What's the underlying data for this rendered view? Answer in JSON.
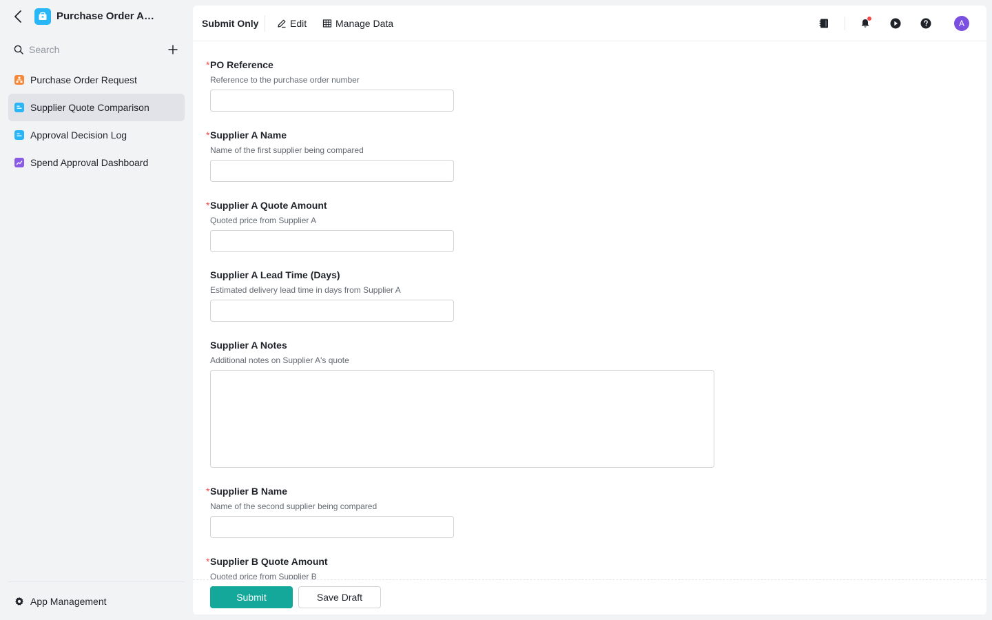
{
  "app": {
    "title": "Purchase Order App...",
    "icon": "app-icon",
    "accent_color": "#29b6f6"
  },
  "search": {
    "placeholder": "Search"
  },
  "sidebar": {
    "items": [
      {
        "label": "Purchase Order Request",
        "icon": "workflow-icon",
        "color": "#f5883b",
        "active": false
      },
      {
        "label": "Supplier Quote Comparison",
        "icon": "form-icon",
        "color": "#29b6f6",
        "active": true
      },
      {
        "label": "Approval Decision Log",
        "icon": "form-icon",
        "color": "#29b6f6",
        "active": false
      },
      {
        "label": "Spend Approval Dashboard",
        "icon": "chart-icon",
        "color": "#8a5ce6",
        "active": false
      }
    ],
    "footer_label": "App Management"
  },
  "toolbar": {
    "title": "Submit Only",
    "edit_label": "Edit",
    "manage_label": "Manage Data",
    "avatar_letter": "A",
    "avatar_color": "#7b4fe0"
  },
  "form": {
    "fields": [
      {
        "label": "PO Reference",
        "required": true,
        "description": "Reference to the purchase order number",
        "type": "input",
        "value": ""
      },
      {
        "label": "Supplier A Name",
        "required": true,
        "description": "Name of the first supplier being compared",
        "type": "input",
        "value": ""
      },
      {
        "label": "Supplier A Quote Amount",
        "required": true,
        "description": "Quoted price from Supplier A",
        "type": "input",
        "value": ""
      },
      {
        "label": "Supplier A Lead Time (Days)",
        "required": false,
        "description": "Estimated delivery lead time in days from Supplier A",
        "type": "input",
        "value": ""
      },
      {
        "label": "Supplier A Notes",
        "required": false,
        "description": "Additional notes on Supplier A's quote",
        "type": "textarea",
        "value": ""
      },
      {
        "label": "Supplier B Name",
        "required": true,
        "description": "Name of the second supplier being compared",
        "type": "input",
        "value": ""
      },
      {
        "label": "Supplier B Quote Amount",
        "required": true,
        "description": "Quoted price from Supplier B",
        "type": "input",
        "value": ""
      }
    ],
    "required_marker": "*"
  },
  "footer": {
    "submit_label": "Submit",
    "draft_label": "Save Draft",
    "submit_color": "#14a89a"
  }
}
